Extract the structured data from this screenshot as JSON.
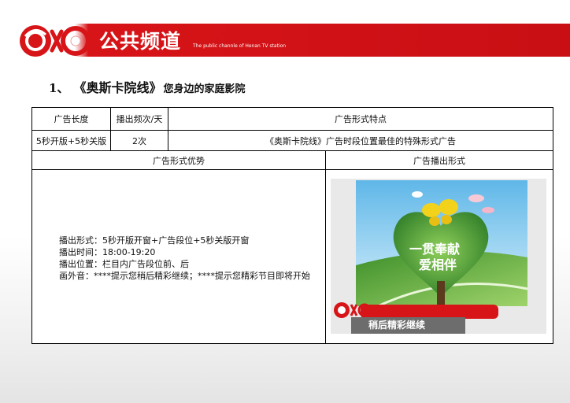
{
  "header": {
    "channel_name": "公共频道",
    "channel_en": "The public channle of Henan TV station"
  },
  "title": {
    "number": "1、",
    "name": "《奥斯卡院线》",
    "subtitle": "您身边的家庭影院"
  },
  "table": {
    "headers": [
      "广告长度",
      "播出频次/天",
      "广告形式特点"
    ],
    "row": [
      "5秒开版+5秒关版",
      "2次",
      "《奥斯卡院线》广告时段位置最佳的特殊形式广告"
    ],
    "section_headers": [
      "广告形式优势",
      "广告播出形式"
    ],
    "advantages": [
      "播出形式：5秒开版开窗+广告段位+5秒关版开窗",
      "播出时间：18:00-19:20",
      "播出位置：栏目内广告段位前、后",
      "画外音：****提示您稍后精彩继续；****提示您精彩节目即将开始"
    ]
  },
  "ad_screenshot": {
    "caption": "稍后精彩继续",
    "slogan_line1": "一贯奉献",
    "slogan_line2": "爱相伴"
  },
  "colors": {
    "brand_red": "#d71418",
    "header_red": "#c90f14"
  }
}
